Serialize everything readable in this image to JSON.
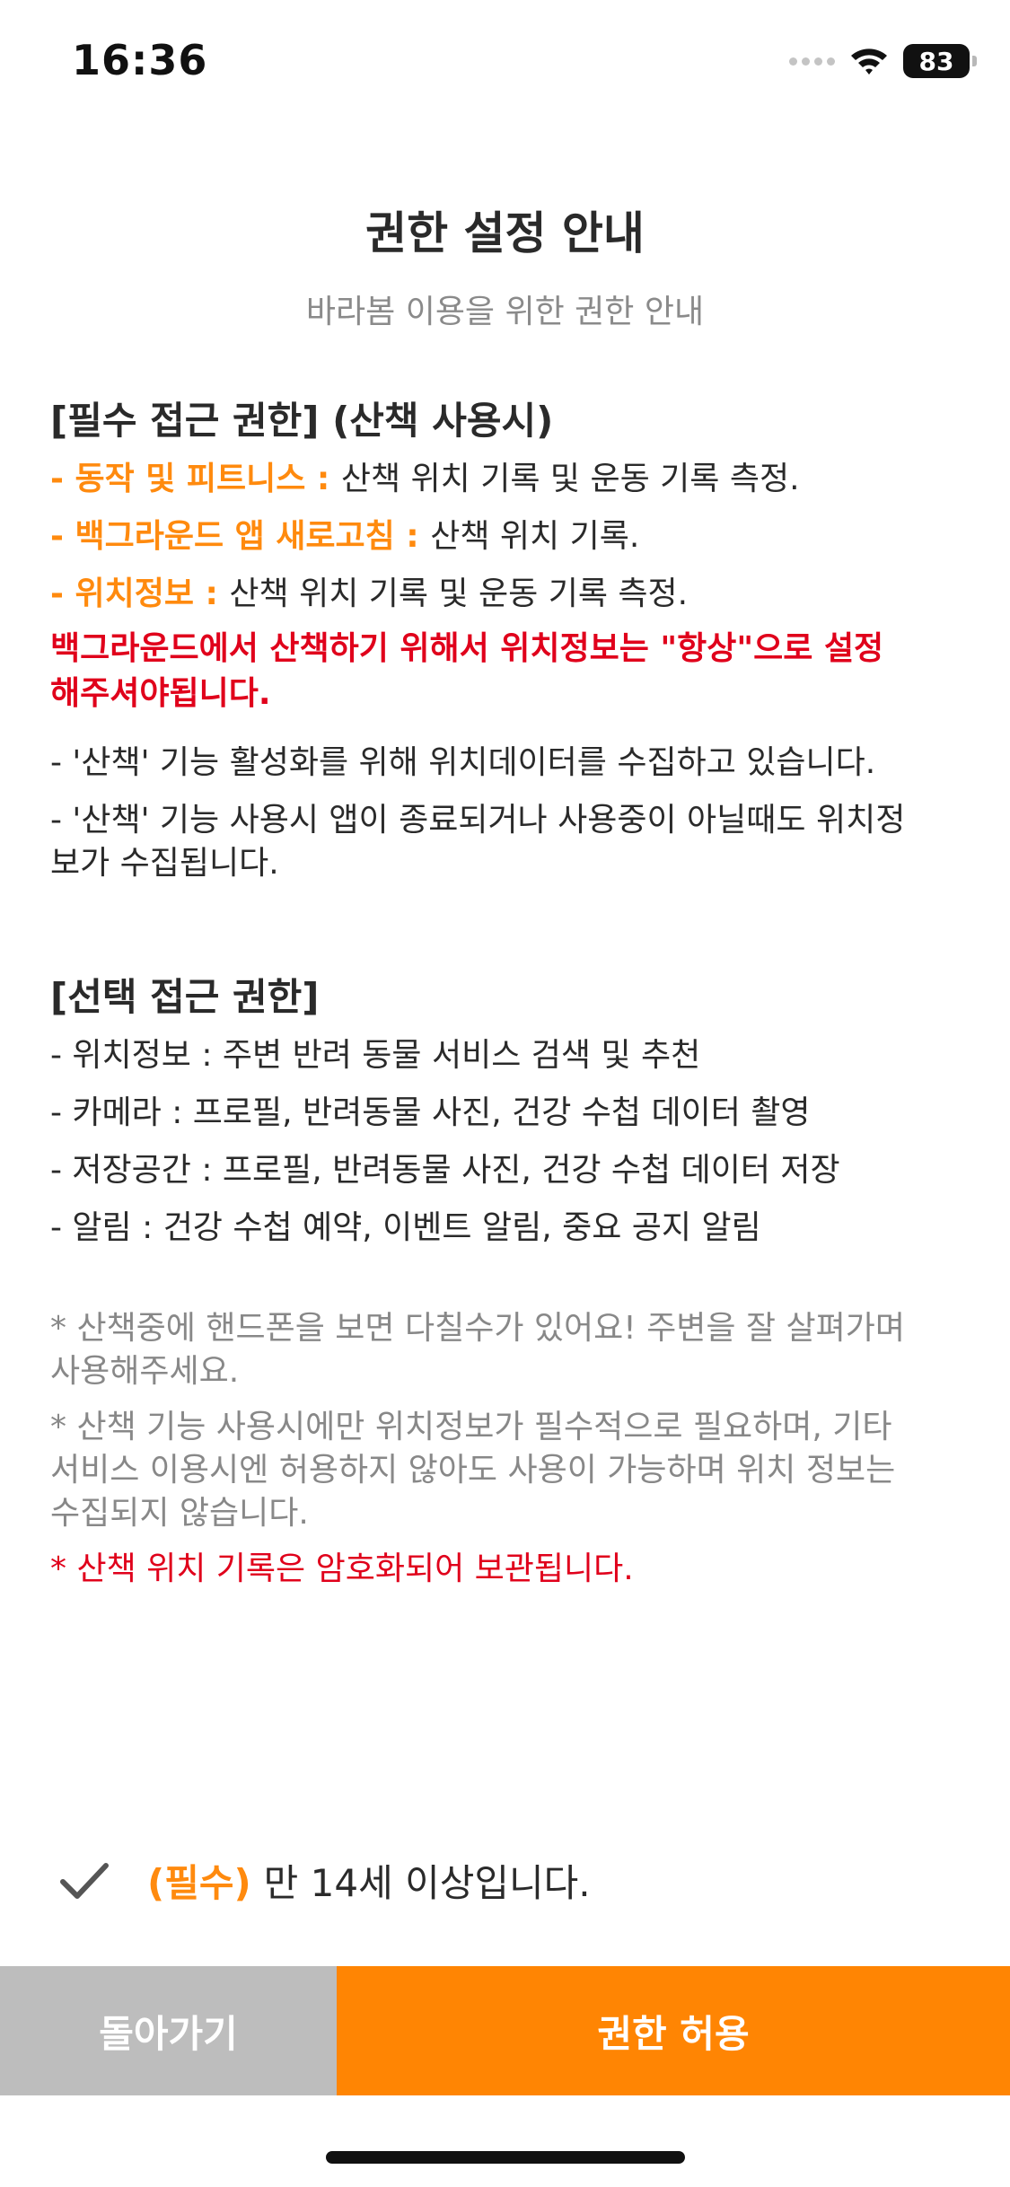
{
  "status_bar": {
    "time": "16:36",
    "battery": "83"
  },
  "header": {
    "title": "권한 설정 안내",
    "subtitle": "바라봄 이용을 위한 권한 안내"
  },
  "required_section": {
    "heading": "[필수 접근 권한] (산책 사용시)",
    "items": [
      {
        "label": "- 동작 및 피트니스 : ",
        "desc": "산책 위치 기록 및 운동 기록 측정."
      },
      {
        "label": "- 백그라운드 앱 새로고침 : ",
        "desc": "산책 위치 기록."
      },
      {
        "label": "- 위치정보 : ",
        "desc": "산책 위치 기록 및 운동 기록 측정."
      }
    ],
    "warning_line1": "백그라운드에서 산책하기 위해서 위치정보는 \"항상\"으로 설정",
    "warning_line2": "해주셔야됩니다.",
    "info1": "- '산책' 기능 활성화를 위해 위치데이터를 수집하고 있습니다.",
    "info2_line1": "- '산책' 기능 사용시 앱이 종료되거나 사용중이 아닐때도 위치정",
    "info2_line2": "보가 수집됩니다."
  },
  "optional_section": {
    "heading": "[선택 접근 권한]",
    "items": [
      "- 위치정보 : 주변 반려 동물 서비스 검색 및 추천",
      "- 카메라 : 프로필, 반려동물 사진, 건강 수첩 데이터 촬영",
      "- 저장공간 : 프로필, 반려동물 사진, 건강 수첩 데이터 저장",
      "- 알림 : 건강 수첩 예약, 이벤트 알림, 중요 공지 알림"
    ]
  },
  "notes": {
    "note1_line1": "* 산책중에 핸드폰을 보면 다칠수가 있어요! 주변을 잘 살펴가며",
    "note1_line2": "사용해주세요.",
    "note2_line1": "* 산책 기능 사용시에만 위치정보가 필수적으로 필요하며, 기타",
    "note2_line2": "서비스 이용시엔 허용하지 않아도 사용이 가능하며 위치 정보는",
    "note2_line3": "수집되지 않습니다.",
    "note3": "* 산책 위치 기록은 암호화되어 보관됩니다."
  },
  "agreement": {
    "required_tag": "(필수)",
    "text": "만 14세 이상입니다."
  },
  "buttons": {
    "back": "돌아가기",
    "allow": "권한 허용"
  },
  "colors": {
    "accent_orange": "#ff8503",
    "warning_red": "#e0001b",
    "back_button_gray": "#bdbdbd"
  }
}
